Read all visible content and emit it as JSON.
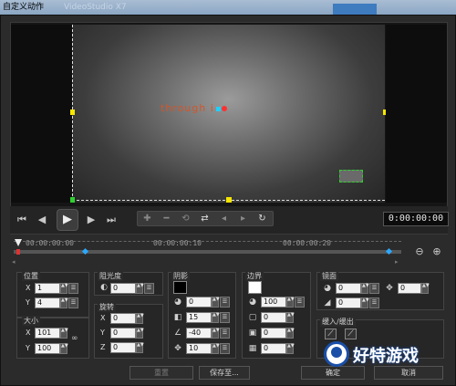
{
  "window": {
    "title": "自定义动作",
    "bg_title": "VideoStudio X7"
  },
  "preview": {
    "overlay_text": "through"
  },
  "transport": {
    "btn_home": "⏮",
    "btn_prev": "◀",
    "btn_play": "▶",
    "btn_next": "▶",
    "btn_end": "⏭",
    "timecode": "0:00:00:00"
  },
  "timeline": {
    "t0": "00:00:00:00",
    "t1": "00:00:00:10",
    "t2": "00:00:00:20"
  },
  "panels": {
    "position": {
      "title": "位置",
      "x": "1",
      "y": "4"
    },
    "size": {
      "title": "大小",
      "x": "101",
      "y": "100"
    },
    "opacity": {
      "title": "阻光度",
      "value": "0"
    },
    "rotation": {
      "title": "旋转",
      "x": "0",
      "y": "0",
      "z": "0"
    },
    "shadow": {
      "title": "阴影",
      "v1": "0",
      "v2": "15",
      "v3": "-40",
      "v4": "10",
      "color": "#000000"
    },
    "border": {
      "title": "边界",
      "v1": "100",
      "v2": "0",
      "v3": "0",
      "v4": "0",
      "color": "#ffffff"
    },
    "mirror": {
      "title": "镜面",
      "v1": "0",
      "v2": "0",
      "v3": "0"
    },
    "ease": {
      "title": "缓入/缓出"
    }
  },
  "axes": {
    "x": "X",
    "y": "Y",
    "z": "Z"
  },
  "buttons": {
    "reset": "重置",
    "save_to": "保存至...",
    "ok": "确定",
    "cancel": "取消"
  },
  "watermark": {
    "text": "好特游戏"
  },
  "colors": {
    "accent_yellow": "#f7e600",
    "watermark_blue": "#1a4fa8"
  }
}
